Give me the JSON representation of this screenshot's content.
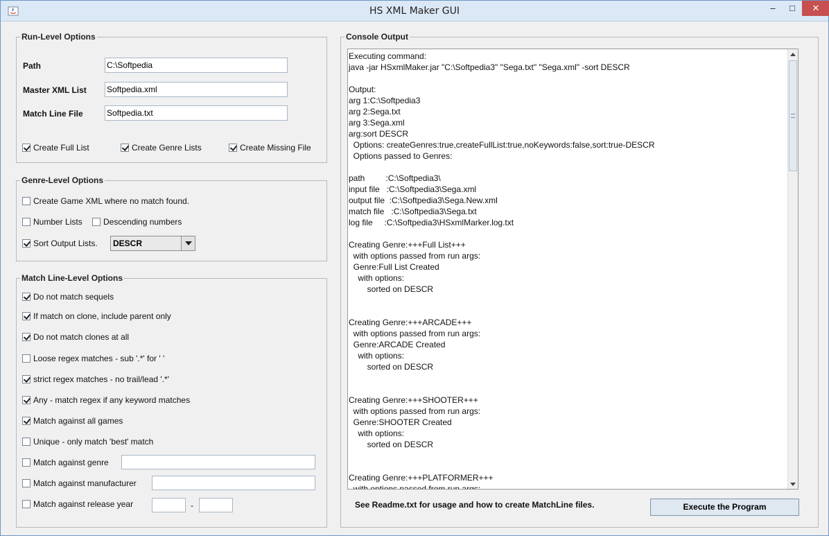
{
  "window": {
    "title": "HS XML Maker GUI",
    "minimize": "‒",
    "maximize": "□",
    "close": "✕"
  },
  "run_level": {
    "title": "Run-Level Options",
    "path_label": "Path",
    "path_value": "C:\\Softpedia",
    "master_label": "Master XML List",
    "master_value": "Softpedia.xml",
    "match_label": "Match Line File",
    "match_value": "Softpedia.txt",
    "create_full_list": {
      "label": "Create Full List",
      "checked": true
    },
    "create_genre_lists": {
      "label": "Create Genre Lists",
      "checked": true
    },
    "create_missing_file": {
      "label": "Create Missing File",
      "checked": true
    }
  },
  "genre_level": {
    "title": "Genre-Level Options",
    "create_game_xml": {
      "label": "Create Game XML where no match found.",
      "checked": false
    },
    "number_lists": {
      "label": "Number Lists",
      "checked": false
    },
    "descending_numbers": {
      "label": "Descending numbers",
      "checked": false
    },
    "sort_output": {
      "label": "Sort Output Lists.",
      "checked": true
    },
    "sort_order": "DESCR"
  },
  "match_level": {
    "title": "Match Line-Level Options",
    "options": [
      {
        "label": "Do not match sequels",
        "checked": true
      },
      {
        "label": "If match on clone, include parent only",
        "checked": true
      },
      {
        "label": "Do not match clones at all",
        "checked": true
      },
      {
        "label": "Loose regex matches - sub '.*' for ' '",
        "checked": false
      },
      {
        "label": "strict regex matches - no trail/lead '.*'",
        "checked": true
      },
      {
        "label": "Any - match regex if any keyword matches",
        "checked": true
      },
      {
        "label": "Match against all games",
        "checked": true
      },
      {
        "label": "Unique - only match 'best' match",
        "checked": false
      }
    ],
    "genre": {
      "label": "Match against genre",
      "checked": false,
      "value": ""
    },
    "manufacturer": {
      "label": "Match against manufacturer",
      "checked": false,
      "value": ""
    },
    "release_year": {
      "label": "Match against release year",
      "checked": false,
      "from": "",
      "to": "",
      "sep": "-"
    }
  },
  "console": {
    "title": "Console Output",
    "text": "Executing command:\njava -jar HSxmlMaker.jar \"C:\\Softpedia3\" \"Sega.txt\" \"Sega.xml\" -sort DESCR\n\nOutput:\narg 1:C:\\Softpedia3\narg 2:Sega.txt\narg 3:Sega.xml\narg:sort DESCR\n  Options: createGenres:true,createFullList:true,noKeywords:false,sort:true-DESCR\n  Options passed to Genres:\n\npath         :C:\\Softpedia3\\\ninput file   :C:\\Softpedia3\\Sega.xml\noutput file  :C:\\Softpedia3\\Sega.New.xml\nmatch file   :C:\\Softpedia3\\Sega.txt\nlog file     :C:\\Softpedia3\\HSxmlMarker.log.txt\n\nCreating Genre:+++Full List+++\n  with options passed from run args:\n  Genre:Full List Created\n    with options:\n        sorted on DESCR\n\n\nCreating Genre:+++ARCADE+++\n  with options passed from run args:\n  Genre:ARCADE Created\n    with options:\n        sorted on DESCR\n\n\nCreating Genre:+++SHOOTER+++\n  with options passed from run args:\n  Genre:SHOOTER Created\n    with options:\n        sorted on DESCR\n\n\nCreating Genre:+++PLATFORMER+++\n  with options passed from run args:"
  },
  "footer": {
    "readme": "See Readme.txt for usage and how to create MatchLine files.",
    "execute_label": "Execute the Program"
  }
}
